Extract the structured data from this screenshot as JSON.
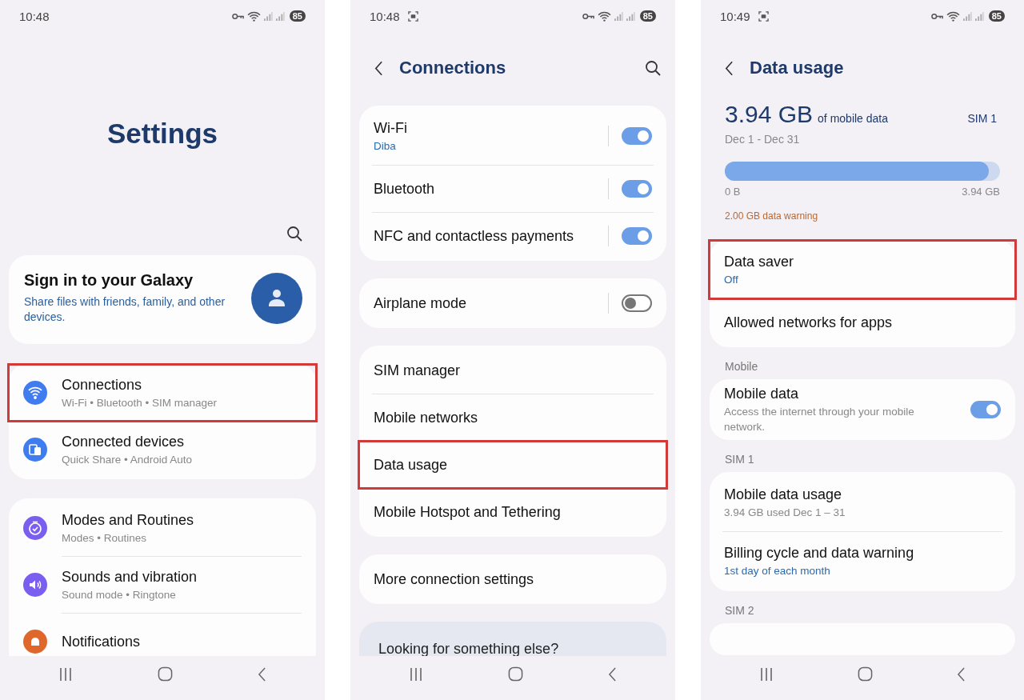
{
  "settings_screen": {
    "status_bar": {
      "time": "10:48",
      "capture_icon": false,
      "battery": "85"
    },
    "title": "Settings",
    "account_card": {
      "title": "Sign in to your Galaxy",
      "subtitle": "Share files with friends, family, and other devices."
    },
    "groups": [
      [
        {
          "title": "Connections",
          "subtitle": "Wi-Fi • Bluetooth • SIM manager",
          "color": "#3f7cf0",
          "highlighted": true
        },
        {
          "title": "Connected devices",
          "subtitle": "Quick Share • Android Auto",
          "color": "#3f7cf0",
          "highlighted": false
        }
      ],
      [
        {
          "title": "Modes and Routines",
          "subtitle": "Modes • Routines",
          "color": "#7a5ef0",
          "highlighted": false
        },
        {
          "title": "Sounds and vibration",
          "subtitle": "Sound mode • Ringtone",
          "color": "#7a5ef0",
          "highlighted": false
        },
        {
          "title": "Notifications",
          "color": "#e0672c",
          "highlighted": false
        }
      ]
    ]
  },
  "connections_screen": {
    "status_bar": {
      "time": "10:48",
      "capture_icon": true,
      "battery": "85"
    },
    "title": "Connections",
    "groups": [
      [
        {
          "title": "Wi-Fi",
          "subtitle": "Diba",
          "kind": "toggle",
          "on": true,
          "highlighted": false
        },
        {
          "title": "Bluetooth",
          "kind": "toggle",
          "on": true,
          "highlighted": false
        },
        {
          "title": "NFC and contactless payments",
          "kind": "toggle",
          "on": true,
          "highlighted": false
        }
      ],
      [
        {
          "title": "Airplane mode",
          "kind": "toggle",
          "on": false,
          "highlighted": false
        }
      ],
      [
        {
          "title": "SIM manager",
          "kind": "link",
          "highlighted": false
        },
        {
          "title": "Mobile networks",
          "kind": "link",
          "highlighted": false
        },
        {
          "title": "Data usage",
          "kind": "link",
          "highlighted": true
        },
        {
          "title": "Mobile Hotspot and Tethering",
          "kind": "link",
          "highlighted": false
        }
      ],
      [
        {
          "title": "More connection settings",
          "kind": "link",
          "highlighted": false
        }
      ]
    ],
    "suggestion_card": {
      "title": "Looking for something else?"
    }
  },
  "data_usage_screen": {
    "status_bar": {
      "time": "10:49",
      "capture_icon": true,
      "battery": "85"
    },
    "title": "Data usage",
    "summary": {
      "amount": "3.94 GB",
      "amount_label": "of mobile data",
      "sim": "SIM 1",
      "period": "Dec 1 - Dec 31",
      "level": 0.96,
      "min_label": "0 B",
      "max_label": "3.94 GB",
      "warning": "2.00 GB data warning"
    },
    "sections": [
      {
        "items": [
          {
            "title": "Data saver",
            "subtitle": "Off",
            "accent": true,
            "kind": "link",
            "highlighted": true
          },
          {
            "title": "Allowed networks for apps",
            "kind": "link",
            "highlighted": false
          }
        ]
      },
      {
        "header": "Mobile",
        "items": [
          {
            "title": "Mobile data",
            "subtitle": "Access the internet through your mobile network.",
            "accent": false,
            "kind": "toggle",
            "on": true,
            "highlighted": false
          }
        ]
      },
      {
        "header": "SIM 1",
        "items": [
          {
            "title": "Mobile data usage",
            "subtitle": "3.94 GB used Dec 1 – 31",
            "accent": false,
            "kind": "link",
            "highlighted": false
          },
          {
            "title": "Billing cycle and data warning",
            "subtitle": "1st day of each month",
            "accent": true,
            "kind": "link",
            "highlighted": false
          }
        ]
      },
      {
        "header": "SIM 2"
      }
    ]
  }
}
